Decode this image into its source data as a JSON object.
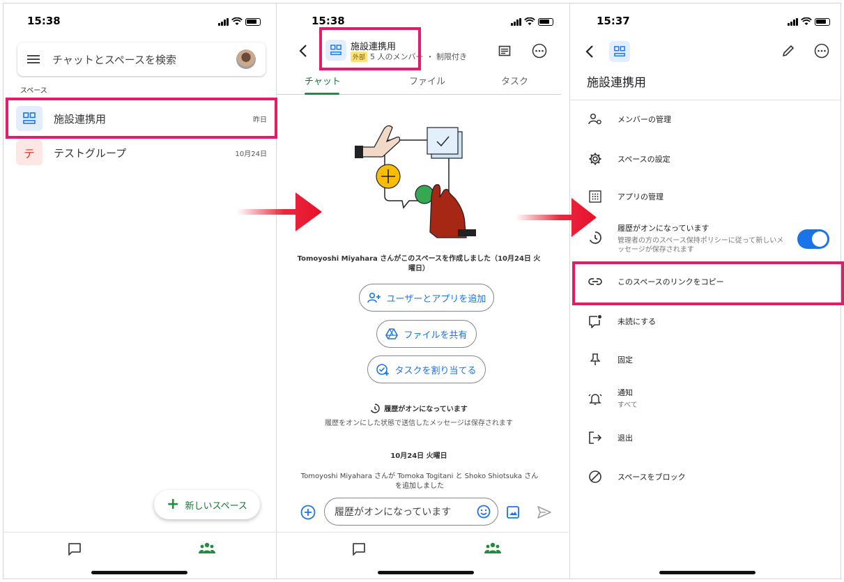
{
  "panel1": {
    "time": "15:38",
    "search_placeholder": "チャットとスペースを検索",
    "section_label": "スペース",
    "spaces": [
      {
        "icon_text": "",
        "name": "施設連携用",
        "date": "昨日"
      },
      {
        "icon_text": "テ",
        "name": "テストグループ",
        "date": "10月24日"
      }
    ],
    "fab_label": "新しいスペース"
  },
  "panel2": {
    "time": "15:38",
    "space_title": "施設連携用",
    "badge": "外部",
    "members": "5 人のメンバー",
    "restricted": "・ 制限付き",
    "tabs": [
      "チャット",
      "ファイル",
      "タスク"
    ],
    "created_msg": "Tomoyoshi Miyahara さんがこのスペースを作成しました（10月24日 火曜日）",
    "actions": [
      "ユーザーとアプリを追加",
      "ファイルを共有",
      "タスクを割り当てる"
    ],
    "history_title": "履歴がオンになっています",
    "history_desc": "履歴をオンにした状態で送信したメッセージは保存されます",
    "date_sep": "10月24日 火曜日",
    "added_msg": "Tomoyoshi Miyahara さんが Tomoka Togitani と Shoko Shiotsuka さんを追加しました",
    "compose_placeholder": "履歴がオンになっています"
  },
  "panel3": {
    "time": "15:37",
    "title": "施設連携用",
    "menu": {
      "manage_members": "メンバーの管理",
      "space_settings": "スペースの設定",
      "manage_apps": "アプリの管理",
      "history_on": "履歴がオンになっています",
      "history_desc": "管理者の方のスペース保持ポリシーに従って新しいメッセージが保存されます",
      "copy_link": "このスペースのリンクをコピー",
      "mark_unread": "未読にする",
      "pin": "固定",
      "notify": "通知",
      "notify_sub": "すべて",
      "leave": "退出",
      "block": "スペースをブロック"
    },
    "history_toggle_on": true
  },
  "colors": {
    "highlight": "#e8196a",
    "arrow": "#e8102a",
    "accent_green": "#1e8e3e",
    "accent_blue": "#1a73e8"
  }
}
